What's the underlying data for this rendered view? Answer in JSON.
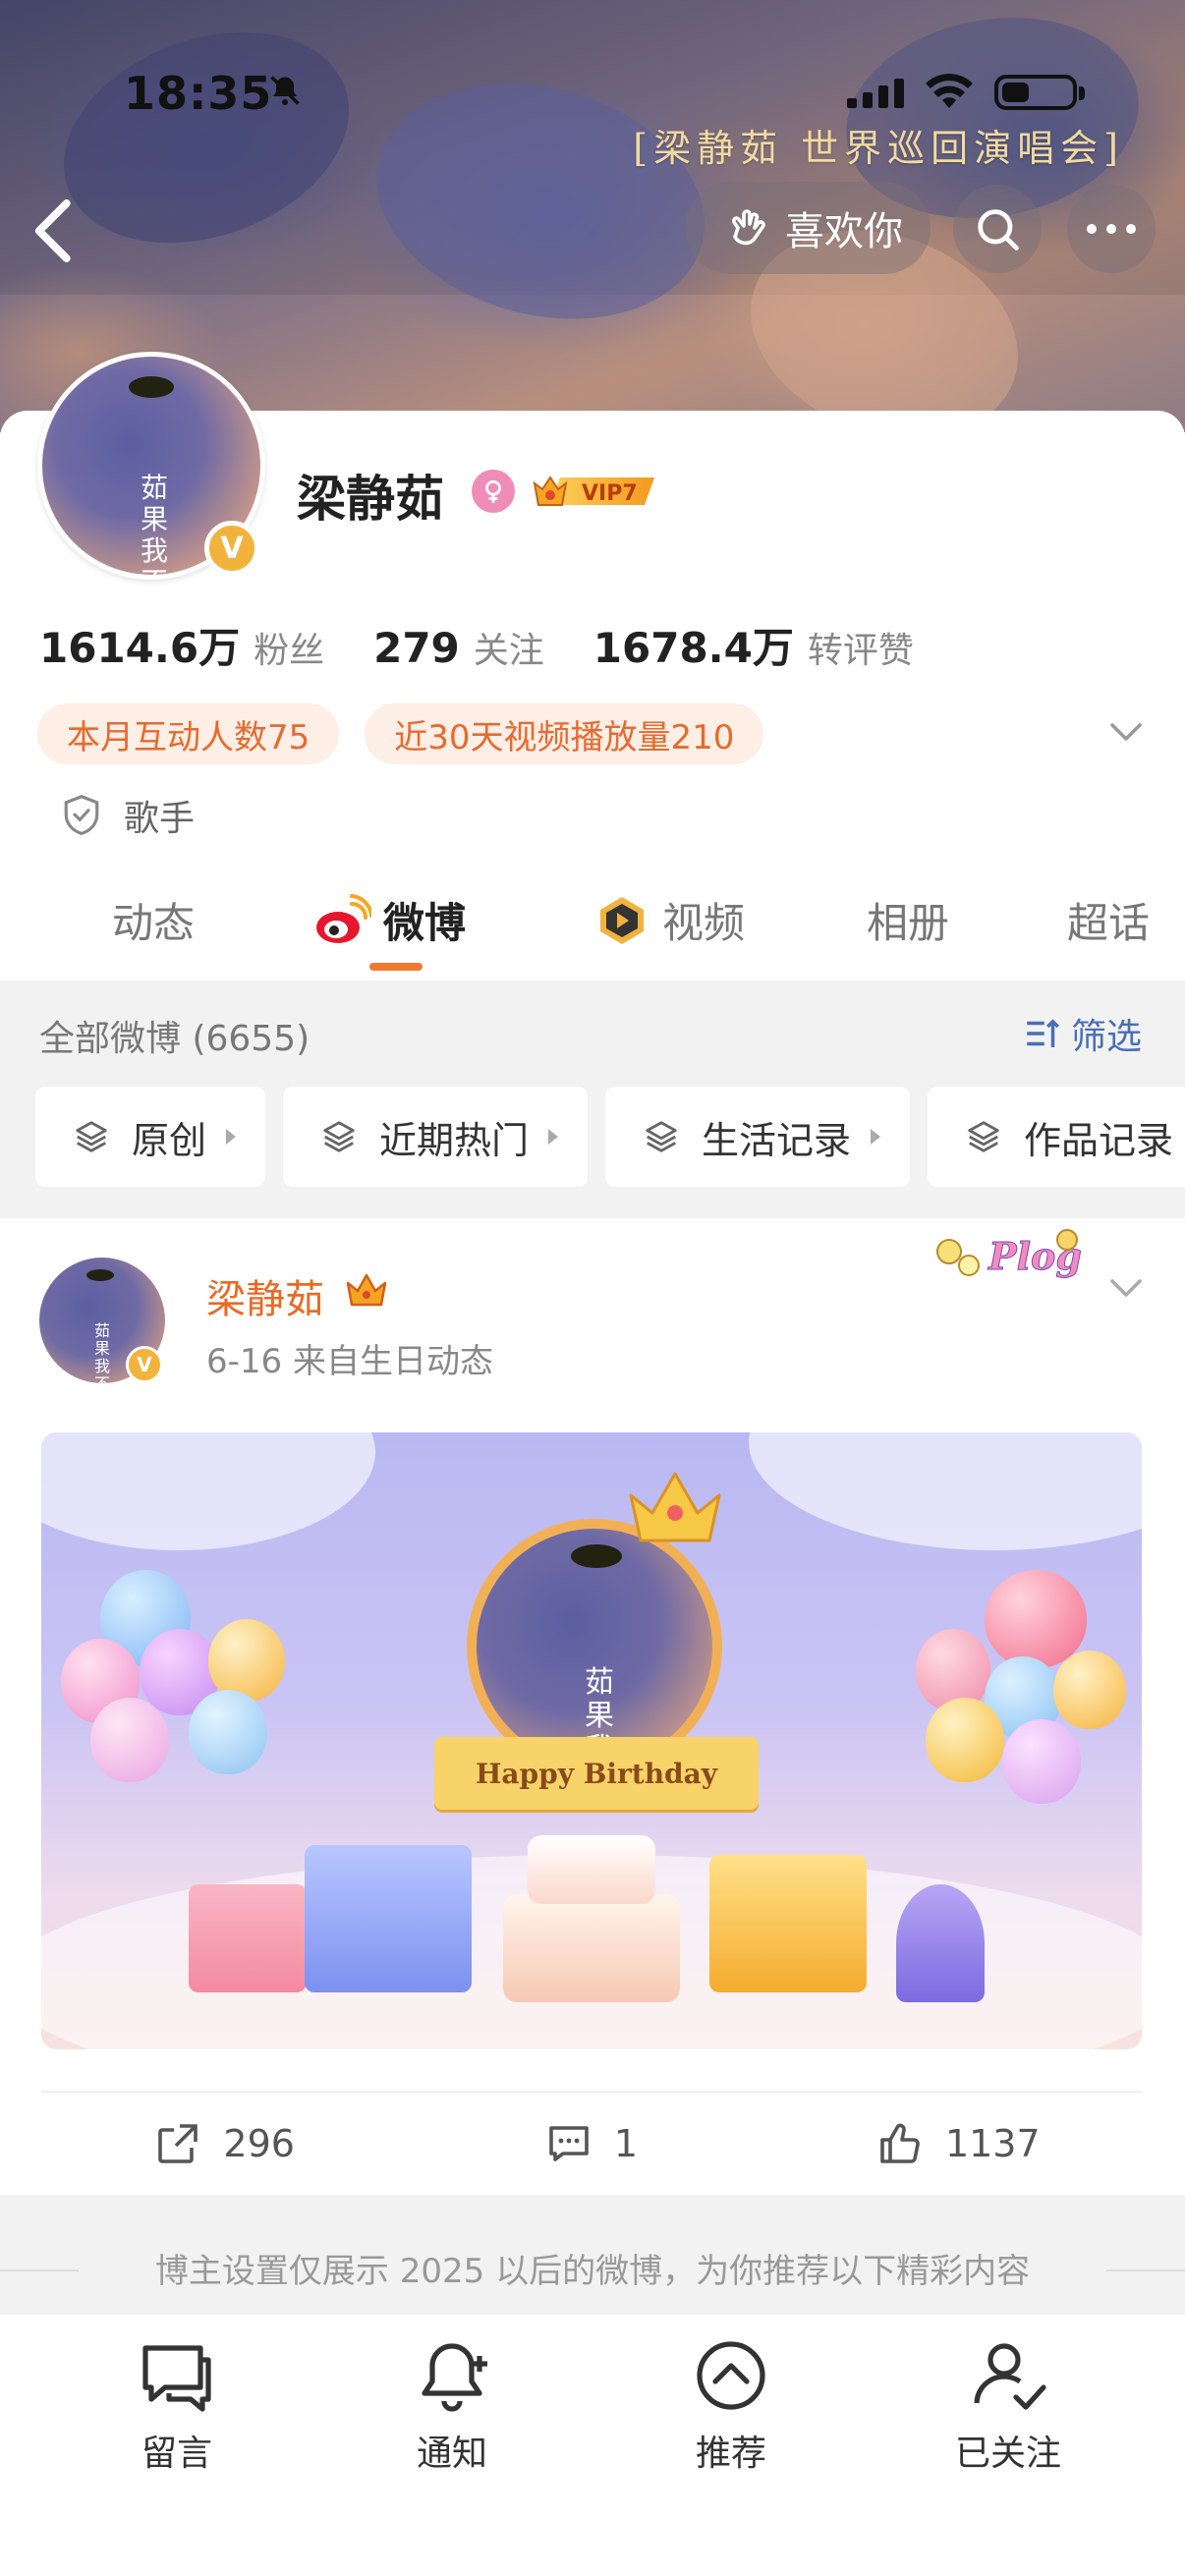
{
  "status_bar": {
    "time": "18:35",
    "battery_level": 0.35,
    "icons": [
      "bell-slash-icon",
      "cellular-signal-icon",
      "wifi-icon",
      "battery-icon"
    ]
  },
  "banner": {
    "tour_text": "[梁静茹 世界巡回演唱会]"
  },
  "header": {
    "like_label": "喜欢你",
    "icons": [
      "back-icon",
      "clap-hand-icon",
      "search-icon",
      "more-icon"
    ]
  },
  "profile": {
    "name": "梁静茹",
    "verified_badge": "V",
    "vip_label": "VIP7",
    "avatar_text": "茹果我不...",
    "stats": [
      {
        "value": "1614.6万",
        "label": "粉丝"
      },
      {
        "value": "279",
        "label": "关注"
      },
      {
        "value": "1678.4万",
        "label": "转评赞"
      }
    ],
    "chips": [
      "本月互动人数75",
      "近30天视频播放量210"
    ],
    "tag": "歌手"
  },
  "tabs": [
    {
      "label": "动态",
      "active": false
    },
    {
      "label": "微博",
      "active": true
    },
    {
      "label": "视频",
      "active": false
    },
    {
      "label": "相册",
      "active": false
    },
    {
      "label": "超话",
      "active": false
    }
  ],
  "filter": {
    "all_label": "全部微博 (6655)",
    "screen_label": "筛选",
    "pills": [
      "原创",
      "近期热门",
      "生活记录",
      "作品记录"
    ]
  },
  "post": {
    "author": "梁静茹",
    "meta": "6-16  来自生日动态",
    "plog_label": "Plog",
    "image_banner_text": "Happy Birthday",
    "reposts": "296",
    "comments": "1",
    "likes": "1137"
  },
  "notice": "博主设置仅展示 2025 以后的微博，为你推荐以下精彩内容",
  "bottom_bar": [
    {
      "label": "留言",
      "icon": "message-icon"
    },
    {
      "label": "通知",
      "icon": "bell-plus-icon"
    },
    {
      "label": "推荐",
      "icon": "chevron-up-circle-icon"
    },
    {
      "label": "已关注",
      "icon": "user-check-icon"
    }
  ],
  "colors": {
    "accent_orange": "#f07a32",
    "chip_bg": "#fdeee6",
    "chip_text": "#e56b2f",
    "link_blue": "#4a6fb3",
    "vip_gold": "#f1b33c"
  }
}
